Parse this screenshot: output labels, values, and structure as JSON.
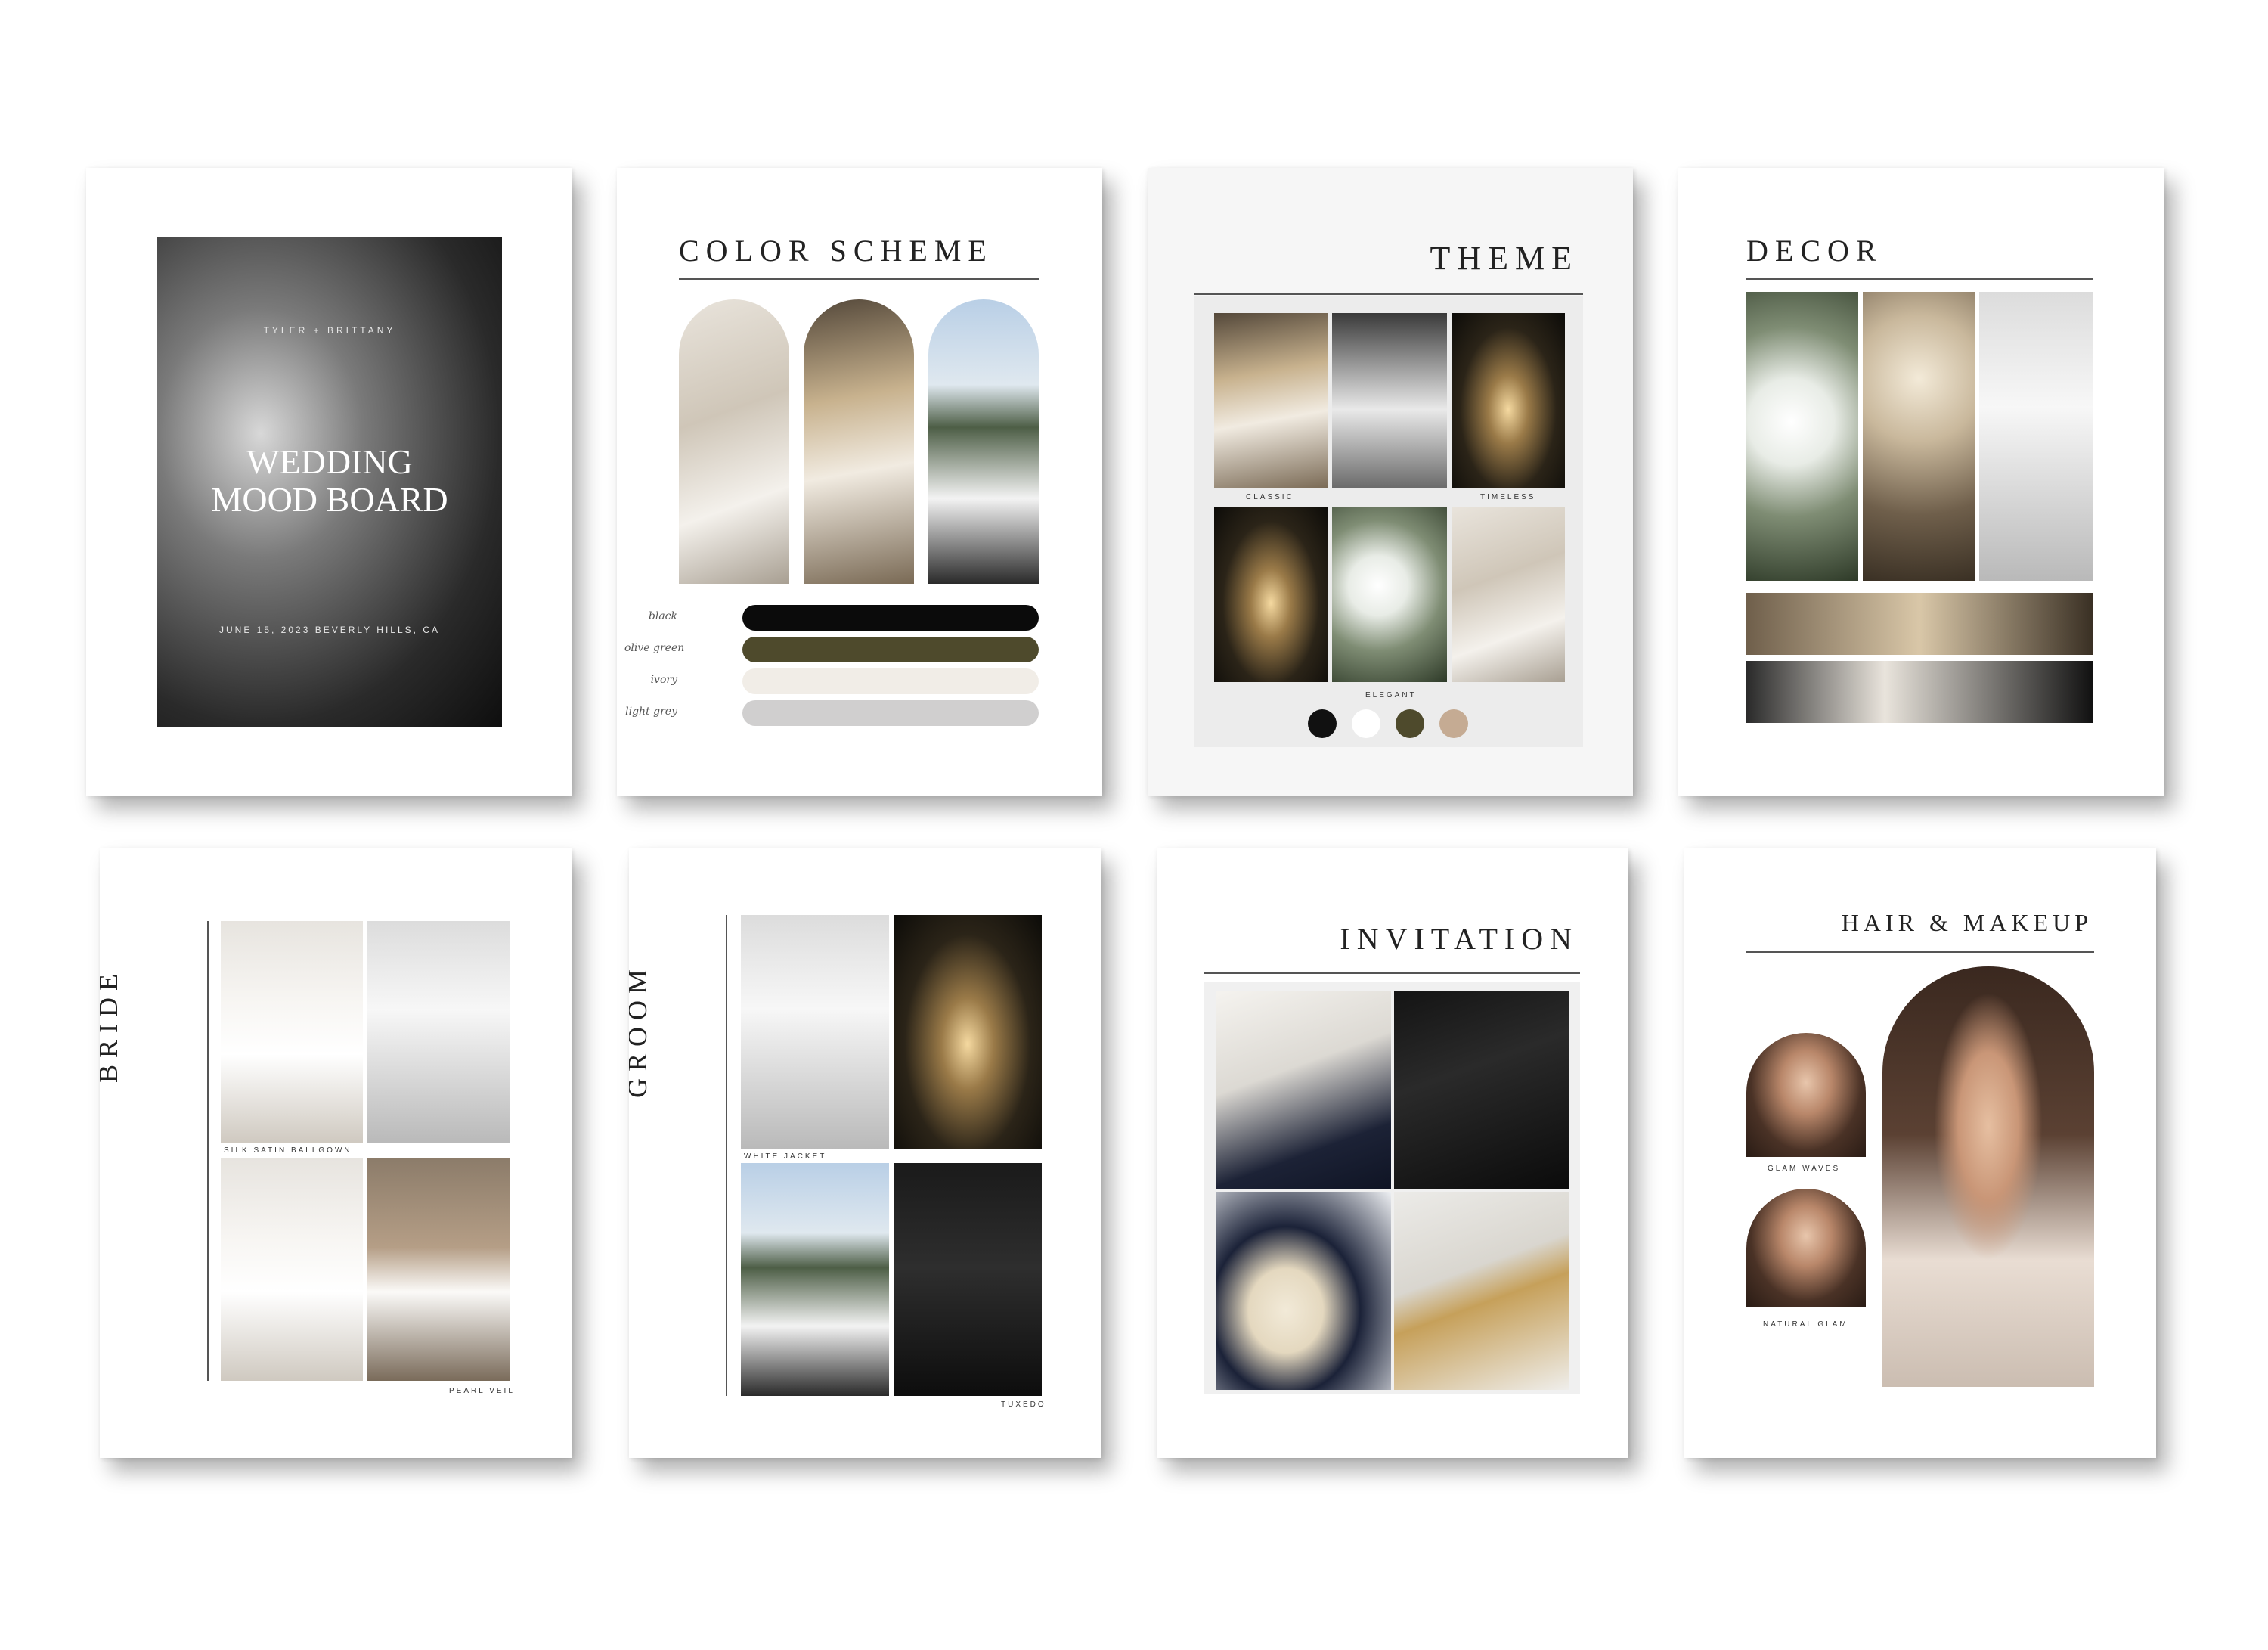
{
  "cover": {
    "couple": "TYLER + BRITTANY",
    "title_line1": "WEDDING",
    "title_line2": "MOOD BOARD",
    "date_location": "JUNE 15, 2023  BEVERLY HILLS, CA"
  },
  "color_scheme": {
    "title": "COLOR SCHEME",
    "swatches": [
      {
        "label": "black",
        "color": "#0b0b0b"
      },
      {
        "label": "olive green",
        "color": "#4e4a2c"
      },
      {
        "label": "ivory",
        "color": "#f1ede7"
      },
      {
        "label": "light grey",
        "color": "#d0cfcf"
      }
    ]
  },
  "theme": {
    "title": "THEME",
    "captions": [
      "CLASSIC",
      "TIMELESS",
      "ELEGANT"
    ],
    "dots": [
      "#111111",
      "#ffffff",
      "#4e4a2c",
      "#c5ab93"
    ]
  },
  "decor": {
    "title": "DECOR"
  },
  "bride": {
    "title": "BRIDE",
    "captions": [
      "SILK SATIN BALLGOWN",
      "PEARL VEIL"
    ]
  },
  "groom": {
    "title": "GROOM",
    "captions": [
      "WHITE JACKET",
      "TUXEDO"
    ]
  },
  "invitation": {
    "title": "INVITATION"
  },
  "hair_makeup": {
    "title": "HAIR & MAKEUP",
    "captions": [
      "GLAM WAVES",
      "NATURAL GLAM"
    ]
  }
}
